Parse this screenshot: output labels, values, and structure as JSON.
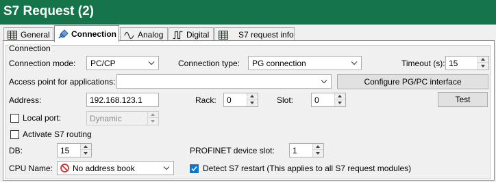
{
  "window": {
    "title": "S7 Request (2)"
  },
  "tabs": [
    {
      "label": "General"
    },
    {
      "label": "Connection"
    },
    {
      "label": "Analog"
    },
    {
      "label": "Digital"
    },
    {
      "label": "S7 request info"
    }
  ],
  "connection": {
    "group_title": "Connection",
    "mode_label": "Connection mode:",
    "mode_value": "PC/CP",
    "type_label": "Connection type:",
    "type_value": "PG connection",
    "timeout_label": "Timeout (s):",
    "timeout_value": "15",
    "access_point_label": "Access point for applications:",
    "access_point_value": "",
    "configure_button": "Configure PG/PC interface",
    "address_label": "Address:",
    "address_value": "192.168.123.1",
    "rack_label": "Rack:",
    "rack_value": "0",
    "slot_label": "Slot:",
    "slot_value": "0",
    "test_button": "Test",
    "local_port_label": "Local port:",
    "local_port_checked": false,
    "local_port_value": "Dynamic",
    "s7_routing_label": "Activate S7 routing",
    "s7_routing_checked": false,
    "db_label": "DB:",
    "db_value": "15",
    "profinet_slot_label": "PROFINET device slot:",
    "profinet_slot_value": "1",
    "cpu_name_label": "CPU Name:",
    "cpu_name_value": "No address book",
    "detect_restart_label": "Detect S7 restart (This applies to all S7 request modules)",
    "detect_restart_checked": true
  },
  "colors": {
    "title_bar": "#16744a",
    "check_accent": "#0078d7",
    "no_entry_icon": "#d62d2d"
  },
  "icons": {
    "general_tab": "grid-table-icon",
    "connection_tab": "plug-connector-icon",
    "analog_tab": "sine-wave-icon",
    "digital_tab": "square-wave-icon",
    "s7_info_tab": "grid-table-icon",
    "cpu_name": "no-entry-icon"
  }
}
